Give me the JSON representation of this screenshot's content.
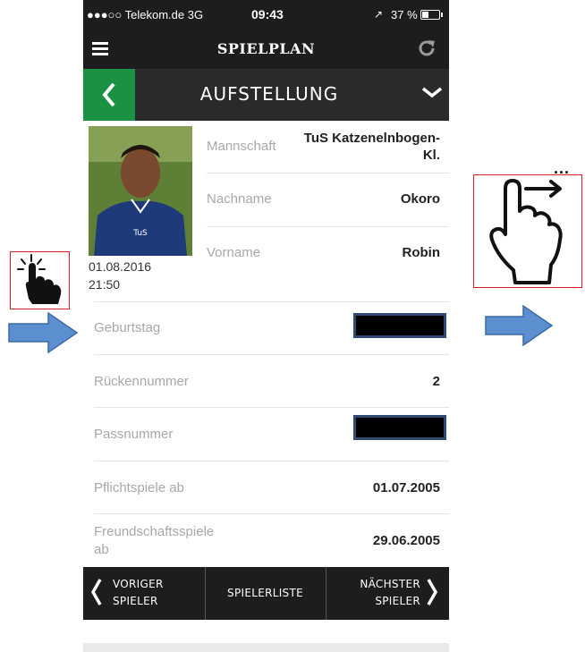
{
  "status_bar": {
    "carrier": "●●●○○ Telekom.de  3G",
    "time": "09:43",
    "location_glyph": "↗",
    "battery_text": "37 %",
    "battery_level": 0.37
  },
  "top_bar": {
    "title": "SPIELPLAN"
  },
  "sub_bar": {
    "title": "AUFSTELLUNG"
  },
  "player": {
    "photo_date": "01.08.2016",
    "photo_time": "21:50",
    "fields": [
      {
        "label": "Mannschaft",
        "value": "TuS Katzenelnbogen-\nKl."
      },
      {
        "label": "Nachname",
        "value": "Okoro"
      },
      {
        "label": "Vorname",
        "value": "Robin"
      }
    ]
  },
  "details": [
    {
      "label": "Geburtstag",
      "value": "",
      "redacted": true
    },
    {
      "label": "Rückennummer",
      "value": "2"
    },
    {
      "label": "Passnummer",
      "value": "",
      "redacted": true
    },
    {
      "label": "Pflichtspiele ab",
      "value": "01.07.2005"
    },
    {
      "label": "Freundschaftsspiele\nab",
      "value": "29.06.2005"
    }
  ],
  "bottom_nav": {
    "prev": "VORIGER\nSPIELER",
    "list": "SPIELERLISTE",
    "next": "NÄCHSTER\nSPIELER"
  },
  "annotations": {
    "tap_icon": "tap-hand-icon",
    "swipe_icon": "swipe-right-hand-icon",
    "swipe_ellipsis": "...",
    "highlight_color": "#e02020",
    "arrow_color": "#5b8fd0"
  }
}
